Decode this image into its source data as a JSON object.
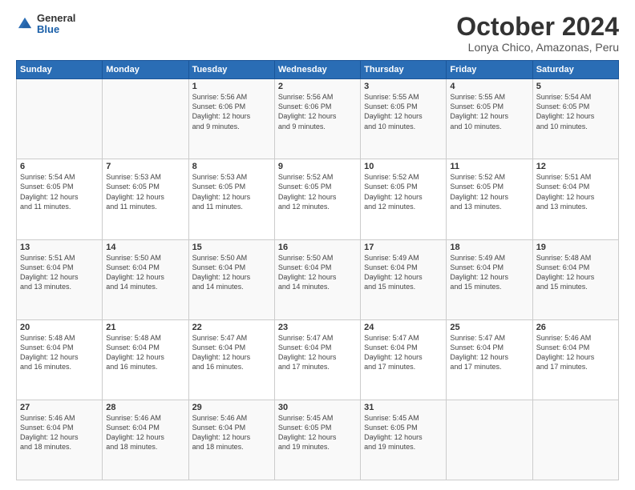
{
  "header": {
    "logo": {
      "general": "General",
      "blue": "Blue"
    },
    "title": "October 2024",
    "subtitle": "Lonya Chico, Amazonas, Peru"
  },
  "calendar": {
    "columns": [
      "Sunday",
      "Monday",
      "Tuesday",
      "Wednesday",
      "Thursday",
      "Friday",
      "Saturday"
    ],
    "weeks": [
      {
        "days": [
          {
            "num": "",
            "info": ""
          },
          {
            "num": "",
            "info": ""
          },
          {
            "num": "1",
            "info": "Sunrise: 5:56 AM\nSunset: 6:06 PM\nDaylight: 12 hours\nand 9 minutes."
          },
          {
            "num": "2",
            "info": "Sunrise: 5:56 AM\nSunset: 6:06 PM\nDaylight: 12 hours\nand 9 minutes."
          },
          {
            "num": "3",
            "info": "Sunrise: 5:55 AM\nSunset: 6:05 PM\nDaylight: 12 hours\nand 10 minutes."
          },
          {
            "num": "4",
            "info": "Sunrise: 5:55 AM\nSunset: 6:05 PM\nDaylight: 12 hours\nand 10 minutes."
          },
          {
            "num": "5",
            "info": "Sunrise: 5:54 AM\nSunset: 6:05 PM\nDaylight: 12 hours\nand 10 minutes."
          }
        ]
      },
      {
        "days": [
          {
            "num": "6",
            "info": "Sunrise: 5:54 AM\nSunset: 6:05 PM\nDaylight: 12 hours\nand 11 minutes."
          },
          {
            "num": "7",
            "info": "Sunrise: 5:53 AM\nSunset: 6:05 PM\nDaylight: 12 hours\nand 11 minutes."
          },
          {
            "num": "8",
            "info": "Sunrise: 5:53 AM\nSunset: 6:05 PM\nDaylight: 12 hours\nand 11 minutes."
          },
          {
            "num": "9",
            "info": "Sunrise: 5:52 AM\nSunset: 6:05 PM\nDaylight: 12 hours\nand 12 minutes."
          },
          {
            "num": "10",
            "info": "Sunrise: 5:52 AM\nSunset: 6:05 PM\nDaylight: 12 hours\nand 12 minutes."
          },
          {
            "num": "11",
            "info": "Sunrise: 5:52 AM\nSunset: 6:05 PM\nDaylight: 12 hours\nand 13 minutes."
          },
          {
            "num": "12",
            "info": "Sunrise: 5:51 AM\nSunset: 6:04 PM\nDaylight: 12 hours\nand 13 minutes."
          }
        ]
      },
      {
        "days": [
          {
            "num": "13",
            "info": "Sunrise: 5:51 AM\nSunset: 6:04 PM\nDaylight: 12 hours\nand 13 minutes."
          },
          {
            "num": "14",
            "info": "Sunrise: 5:50 AM\nSunset: 6:04 PM\nDaylight: 12 hours\nand 14 minutes."
          },
          {
            "num": "15",
            "info": "Sunrise: 5:50 AM\nSunset: 6:04 PM\nDaylight: 12 hours\nand 14 minutes."
          },
          {
            "num": "16",
            "info": "Sunrise: 5:50 AM\nSunset: 6:04 PM\nDaylight: 12 hours\nand 14 minutes."
          },
          {
            "num": "17",
            "info": "Sunrise: 5:49 AM\nSunset: 6:04 PM\nDaylight: 12 hours\nand 15 minutes."
          },
          {
            "num": "18",
            "info": "Sunrise: 5:49 AM\nSunset: 6:04 PM\nDaylight: 12 hours\nand 15 minutes."
          },
          {
            "num": "19",
            "info": "Sunrise: 5:48 AM\nSunset: 6:04 PM\nDaylight: 12 hours\nand 15 minutes."
          }
        ]
      },
      {
        "days": [
          {
            "num": "20",
            "info": "Sunrise: 5:48 AM\nSunset: 6:04 PM\nDaylight: 12 hours\nand 16 minutes."
          },
          {
            "num": "21",
            "info": "Sunrise: 5:48 AM\nSunset: 6:04 PM\nDaylight: 12 hours\nand 16 minutes."
          },
          {
            "num": "22",
            "info": "Sunrise: 5:47 AM\nSunset: 6:04 PM\nDaylight: 12 hours\nand 16 minutes."
          },
          {
            "num": "23",
            "info": "Sunrise: 5:47 AM\nSunset: 6:04 PM\nDaylight: 12 hours\nand 17 minutes."
          },
          {
            "num": "24",
            "info": "Sunrise: 5:47 AM\nSunset: 6:04 PM\nDaylight: 12 hours\nand 17 minutes."
          },
          {
            "num": "25",
            "info": "Sunrise: 5:47 AM\nSunset: 6:04 PM\nDaylight: 12 hours\nand 17 minutes."
          },
          {
            "num": "26",
            "info": "Sunrise: 5:46 AM\nSunset: 6:04 PM\nDaylight: 12 hours\nand 17 minutes."
          }
        ]
      },
      {
        "days": [
          {
            "num": "27",
            "info": "Sunrise: 5:46 AM\nSunset: 6:04 PM\nDaylight: 12 hours\nand 18 minutes."
          },
          {
            "num": "28",
            "info": "Sunrise: 5:46 AM\nSunset: 6:04 PM\nDaylight: 12 hours\nand 18 minutes."
          },
          {
            "num": "29",
            "info": "Sunrise: 5:46 AM\nSunset: 6:04 PM\nDaylight: 12 hours\nand 18 minutes."
          },
          {
            "num": "30",
            "info": "Sunrise: 5:45 AM\nSunset: 6:05 PM\nDaylight: 12 hours\nand 19 minutes."
          },
          {
            "num": "31",
            "info": "Sunrise: 5:45 AM\nSunset: 6:05 PM\nDaylight: 12 hours\nand 19 minutes."
          },
          {
            "num": "",
            "info": ""
          },
          {
            "num": "",
            "info": ""
          }
        ]
      }
    ]
  }
}
